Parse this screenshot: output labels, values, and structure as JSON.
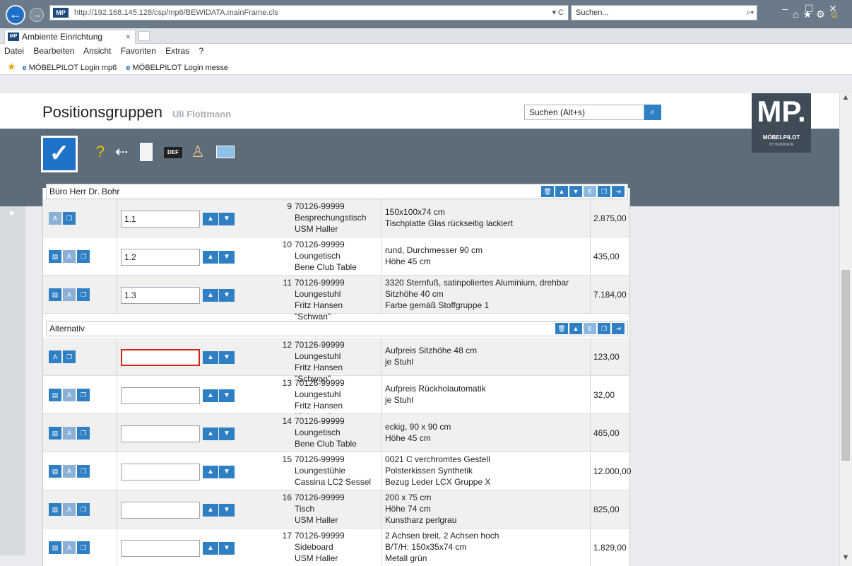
{
  "browser": {
    "url": "http://192.168.145.128/csp/mp6/BEWIDATA.mainFrame.cls",
    "url_tail": "▾ C",
    "search_placeholder": "Suchen...",
    "tab_title": "Ambiente Einrichtung",
    "tab_close": "×",
    "favicon_text": "MP",
    "menu": [
      "Datei",
      "Bearbeiten",
      "Ansicht",
      "Favoriten",
      "Extras",
      "?"
    ],
    "favorites": [
      "MÖBELPILOT Login mp6",
      "MÖBELPILOT Login messe"
    ]
  },
  "app": {
    "title": "Positionsgruppen",
    "user": "Uli Flottmann",
    "search_value": "Suchen (Alt+s)",
    "logo": {
      "mark": "MP.",
      "name": "MÖBELPILOT",
      "sub": "BY BEWIDATA"
    },
    "def_label": "DEF"
  },
  "groups": [
    {
      "name": "Büro Herr Dr. Bohr"
    },
    {
      "name": "Alternativ"
    }
  ],
  "rows_group1": [
    {
      "pos": "1.1",
      "nr": "9",
      "article": "70126-99999",
      "line2": "Besprechungstisch",
      "line3": "USM Haller",
      "desc": [
        "150x100x74 cm",
        "Tischplatte Glas rückseitig lackiert"
      ],
      "price": "2.875,00"
    },
    {
      "pos": "1.2",
      "nr": "10",
      "article": "70126-99999",
      "line2": "Loungetisch",
      "line3": "Bene Club Table",
      "desc": [
        "rund, Durchmesser 90 cm",
        "Höhe 45 cm"
      ],
      "price": "435,00"
    },
    {
      "pos": "1.3",
      "nr": "11",
      "article": "70126-99999",
      "line2": "Loungestuhl",
      "line3": "Fritz Hansen \"Schwan\"",
      "desc": [
        "3320 Sternfuß, satinpoliertes Aluminium, drehbar",
        "Sitzhöhe 40 cm",
        "Farbe gemäß Stoffgruppe 1"
      ],
      "price": "7.184,00"
    }
  ],
  "rows_group2": [
    {
      "pos": "",
      "nr": "12",
      "article": "70126-99999",
      "line2": "Loungestuhl",
      "line3": "Fritz Hansen \"Schwan\"",
      "desc": [
        "Aufpreis Sitzhöhe 48 cm",
        "je Stuhl"
      ],
      "price": "123,00"
    },
    {
      "pos": "",
      "nr": "13",
      "article": "70126-99999",
      "line2": "Loungestuhl",
      "line3": "Fritz Hansen \"Schwan\"",
      "desc": [
        "Aufpreis Rückholautomatik",
        "je Stuhl"
      ],
      "price": "32,00"
    },
    {
      "pos": "",
      "nr": "14",
      "article": "70126-99999",
      "line2": "Loungetisch",
      "line3": "Bene Club Table",
      "desc": [
        "eckig, 90 x 90 cm",
        "Höhe 45 cm"
      ],
      "price": "465,00"
    },
    {
      "pos": "",
      "nr": "15",
      "article": "70126-99999",
      "line2": "Loungestühle",
      "line3": "Cassina LC2 Sessel",
      "desc": [
        "0021 C verchromtes Gestell",
        "Polsterkissen Synthetik",
        "Bezug Leder LCX Gruppe X"
      ],
      "price": "12.000,00"
    },
    {
      "pos": "",
      "nr": "16",
      "article": "70126-99999",
      "line2": "Tisch",
      "line3": "USM Haller",
      "desc": [
        "200 x 75 cm",
        "Höhe 74 cm",
        "Kunstharz perlgrau"
      ],
      "price": "825,00"
    },
    {
      "pos": "",
      "nr": "17",
      "article": "70126-99999",
      "line2": "Sideboard",
      "line3": "USM Haller",
      "desc": [
        "2 Achsen breit, 2 Achsen hoch",
        "B/T/H: 150x35x74 cm",
        "Metall grün"
      ],
      "price": "1.829,00"
    }
  ],
  "colors": {
    "accent": "#2f7fc4",
    "toolbar": "#5d6c79",
    "focus": "#d9231d"
  }
}
